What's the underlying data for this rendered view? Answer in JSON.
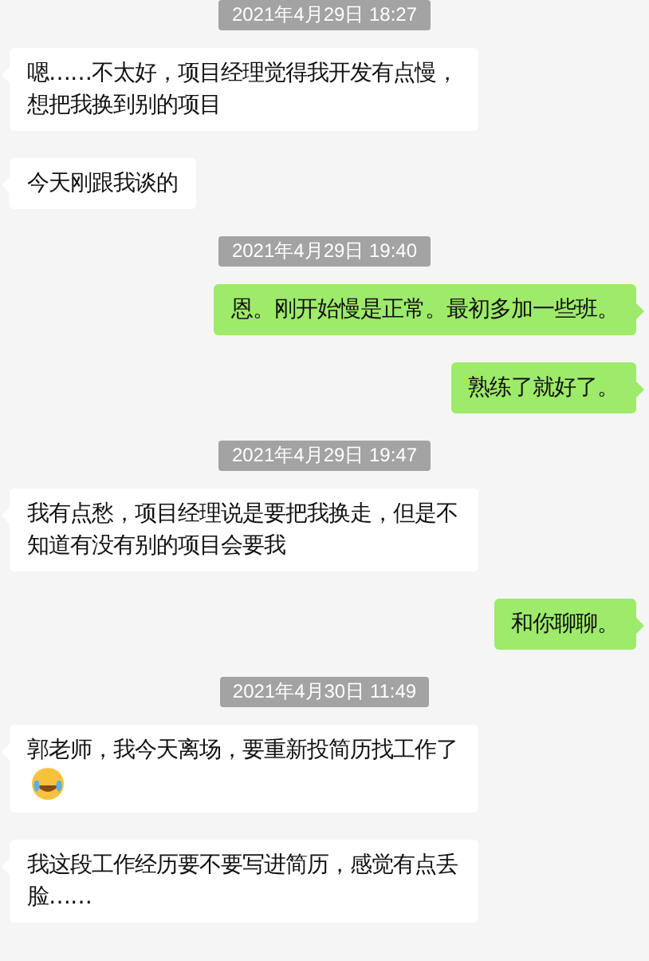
{
  "messages": [
    {
      "kind": "time",
      "text": "2021年4月29日 18:27"
    },
    {
      "kind": "incoming",
      "text": "嗯……不太好，项目经理觉得我开发有点慢，想把我换到别的项目"
    },
    {
      "kind": "incoming",
      "text": "今天刚跟我谈的"
    },
    {
      "kind": "time",
      "text": "2021年4月29日 19:40"
    },
    {
      "kind": "outgoing",
      "text": "恩。刚开始慢是正常。最初多加一些班。"
    },
    {
      "kind": "outgoing",
      "text": "熟练了就好了。"
    },
    {
      "kind": "time",
      "text": "2021年4月29日 19:47"
    },
    {
      "kind": "incoming",
      "text": "我有点愁，项目经理说是要把我换走，但是不知道有没有别的项目会要我"
    },
    {
      "kind": "outgoing",
      "text": "和你聊聊。"
    },
    {
      "kind": "time",
      "text": "2021年4月30日 11:49"
    },
    {
      "kind": "incoming",
      "text": "郭老师，我今天离场，要重新投简历找工作了",
      "has_emoji": true
    },
    {
      "kind": "incoming",
      "text": "我这段工作经历要不要写进简历，感觉有点丢脸……"
    }
  ]
}
